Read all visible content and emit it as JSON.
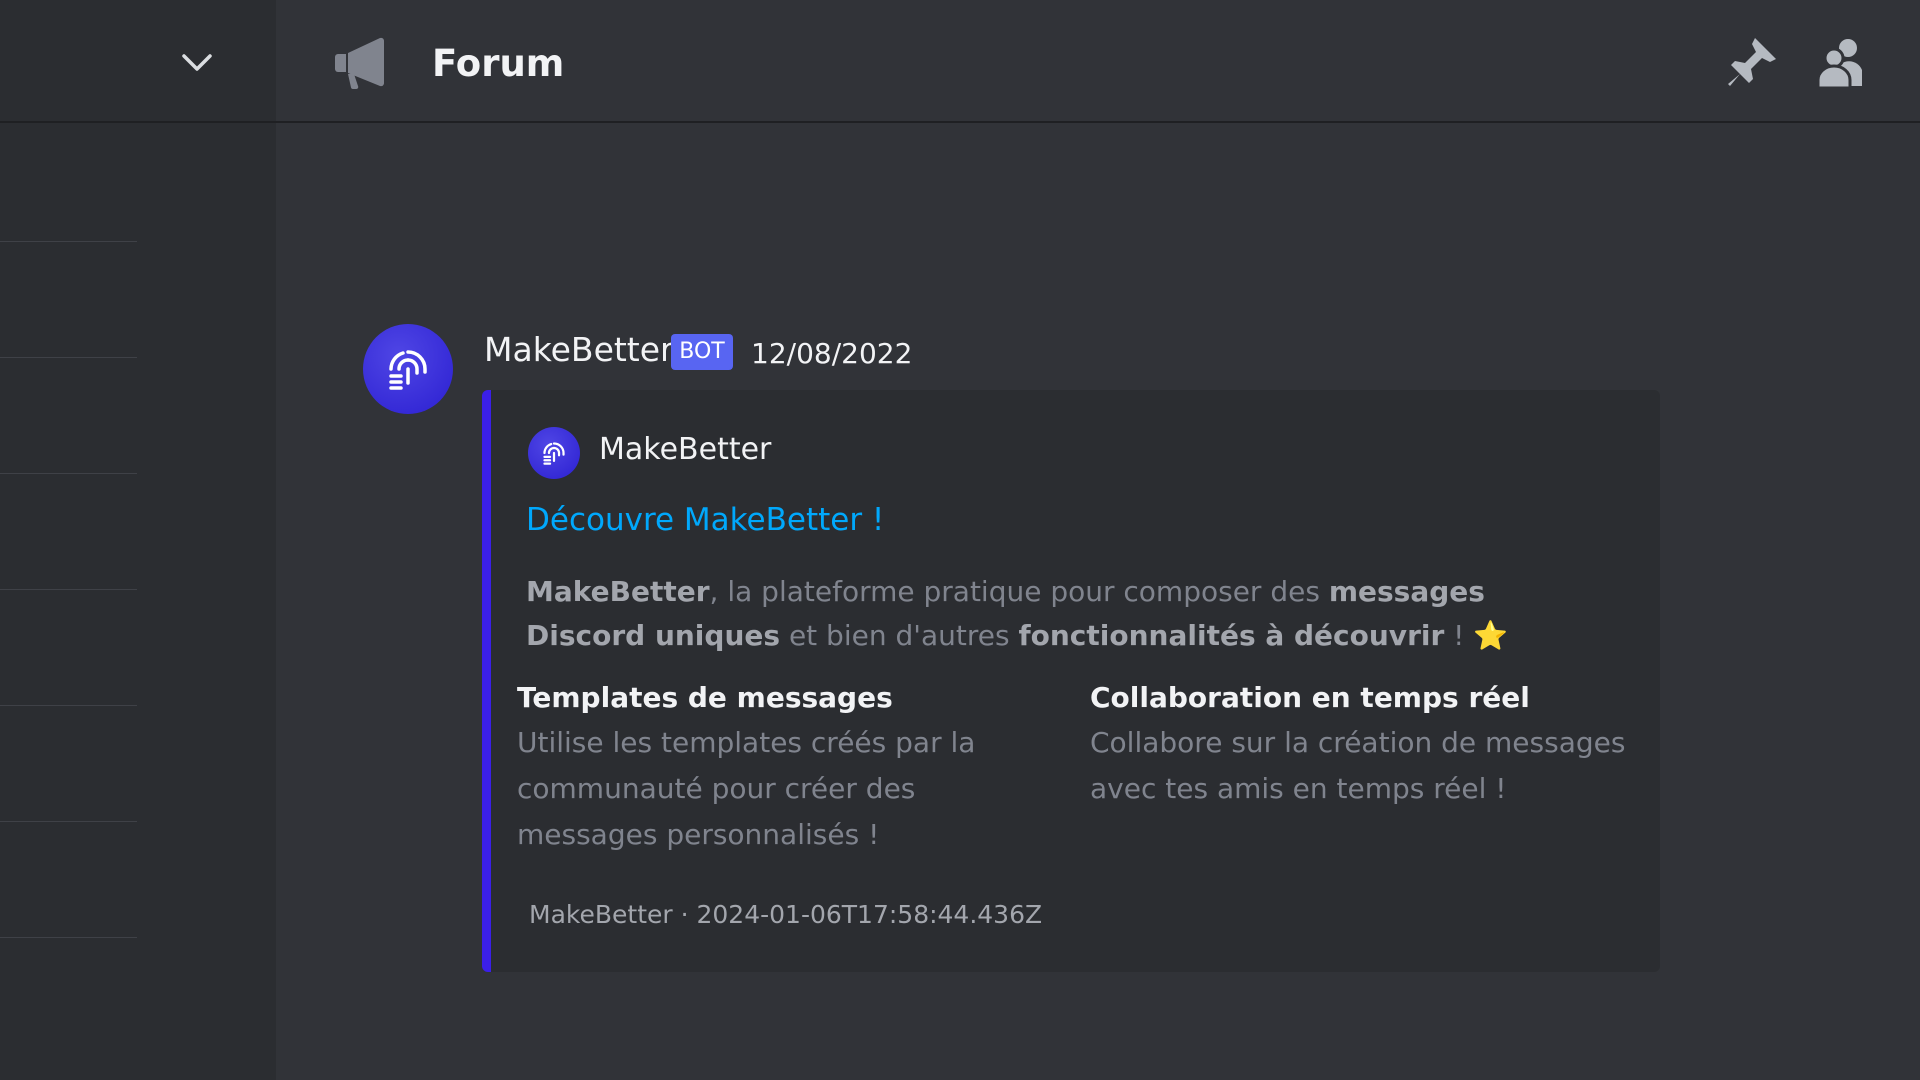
{
  "channel": {
    "title": "Forum",
    "icon": "megaphone-icon"
  },
  "toolbar": {
    "pin_icon": "pin-icon",
    "members_icon": "members-icon"
  },
  "message": {
    "author": "MakeBetter",
    "badge": "BOT",
    "timestamp": "12/08/2022",
    "embed": {
      "accent_color": "#3b1fe8",
      "author_name": "MakeBetter",
      "title": "Découvre MakeBetter !",
      "description": {
        "p1_bold": "MakeBetter",
        "p1_text": ", la plateforme pratique pour composer des ",
        "p1_bold2": "messages Discord uniques",
        "p1_text2": " et bien d'autres ",
        "p1_bold3": "fonctionnalités à découvrir",
        "p1_end": " ! ",
        "emoji": "⭐"
      },
      "fields": [
        {
          "name": "Templates de messages",
          "value": "Utilise les templates créés par la communauté pour créer des messages personnalisés !"
        },
        {
          "name": "Collaboration en temps réel",
          "value": "Collabore sur la création de messages avec tes amis en temps réel !"
        }
      ],
      "footer": "MakeBetter · 2024-01-06T17:58:44.436Z"
    }
  }
}
